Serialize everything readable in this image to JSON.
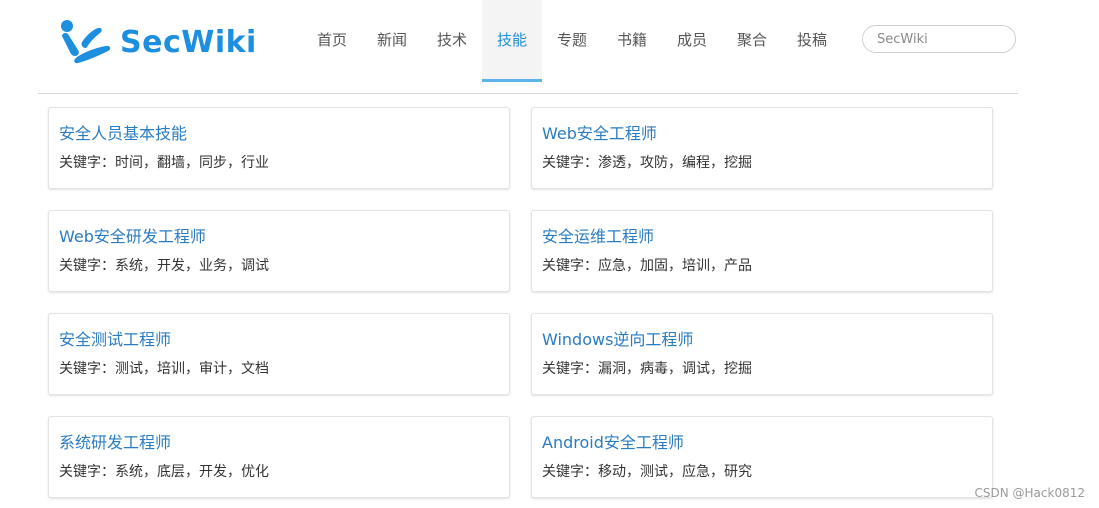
{
  "brand": {
    "name": "SecWiki",
    "color": "#1d8fe0"
  },
  "nav": {
    "items": [
      {
        "label": "首页"
      },
      {
        "label": "新闻"
      },
      {
        "label": "技术"
      },
      {
        "label": "技能",
        "active": true
      },
      {
        "label": "专题"
      },
      {
        "label": "书籍"
      },
      {
        "label": "成员"
      },
      {
        "label": "聚合"
      },
      {
        "label": "投稿"
      }
    ],
    "active_color": "#1f8fd6"
  },
  "search": {
    "placeholder": "SecWiki",
    "value": ""
  },
  "cards": [
    {
      "title": "安全人员基本技能",
      "keywords": "关键字：时间，翻墙，同步，行业"
    },
    {
      "title": "Web安全工程师",
      "keywords": "关键字：渗透，攻防，编程，挖掘"
    },
    {
      "title": "Web安全研发工程师",
      "keywords": "关键字：系统，开发，业务，调试"
    },
    {
      "title": "安全运维工程师",
      "keywords": "关键字：应急，加固，培训，产品"
    },
    {
      "title": "安全测试工程师",
      "keywords": "关键字：测试，培训，审计，文档"
    },
    {
      "title": "Windows逆向工程师",
      "keywords": "关键字：漏洞，病毒，调试，挖掘"
    },
    {
      "title": "系统研发工程师",
      "keywords": "关键字：系统，底层，开发，优化"
    },
    {
      "title": "Android安全工程师",
      "keywords": "关键字：移动，测试，应急，研究"
    }
  ],
  "watermark": "CSDN @Hack0812",
  "colors": {
    "link": "#2a7cc2",
    "text": "#333333"
  }
}
